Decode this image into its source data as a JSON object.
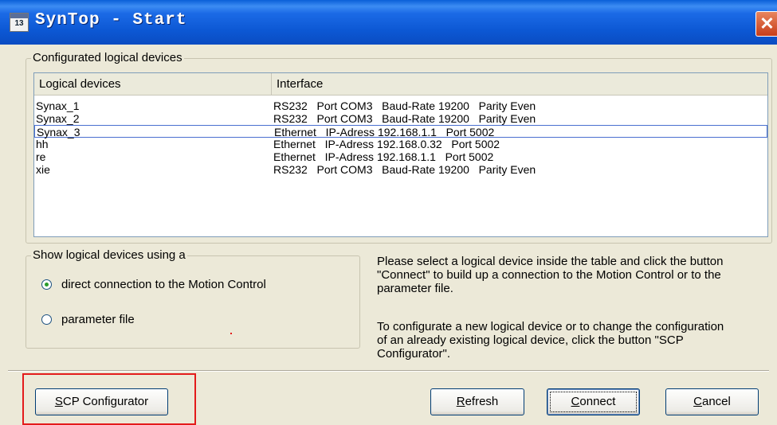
{
  "window": {
    "title": "SynTop - Start",
    "app_icon": "syntop-app-icon",
    "close_glyph": "✕"
  },
  "devices_group": {
    "legend": "Configurated logical devices",
    "columns": [
      "Logical devices",
      "Interface"
    ],
    "rows": [
      {
        "name": "Synax_1",
        "iface": "RS232   Port COM3   Baud-Rate 19200   Parity Even",
        "selected": false
      },
      {
        "name": "Synax_2",
        "iface": "RS232   Port COM3   Baud-Rate 19200   Parity Even",
        "selected": false
      },
      {
        "name": "Synax_3",
        "iface": "Ethernet   IP-Adress 192.168.1.1   Port 5002",
        "selected": true
      },
      {
        "name": "hh",
        "iface": "Ethernet   IP-Adress 192.168.0.32   Port 5002",
        "selected": false
      },
      {
        "name": "re",
        "iface": "Ethernet   IP-Adress 192.168.1.1   Port 5002",
        "selected": false
      },
      {
        "name": "xie",
        "iface": "RS232   Port COM3   Baud-Rate 19200   Parity Even",
        "selected": false
      }
    ],
    "scroll_left": "‹",
    "scroll_right": "›"
  },
  "show_group": {
    "legend": "Show logical devices using a",
    "options": [
      {
        "label": "direct connection to the Motion Control",
        "checked": true
      },
      {
        "label": "parameter file",
        "checked": false
      }
    ]
  },
  "info": {
    "paragraph1": "Please select a logical device inside the table and click the button \"Connect\" to build up a connection to the Motion Control or to the parameter file.",
    "paragraph2": "To configurate a new logical device or to change the configuration of an already existing logical device, click the button \"SCP Configurator\"."
  },
  "buttons": {
    "scp_first": "S",
    "scp_rest": "CP Configurator",
    "refresh_first": "R",
    "refresh_rest": "efresh",
    "connect_first": "C",
    "connect_rest": "onnect",
    "cancel_first": "C",
    "cancel_rest": "ancel"
  },
  "colors": {
    "accent": "#0a5fd8",
    "highlight": "#e31b1b",
    "radio_dot": "#2a9c2a"
  }
}
